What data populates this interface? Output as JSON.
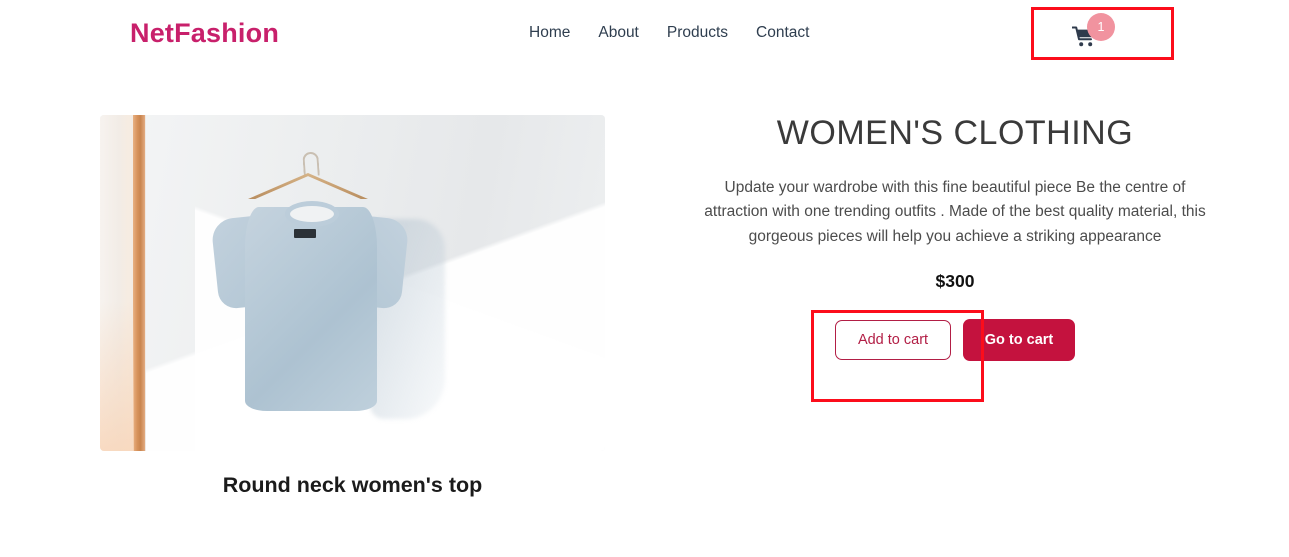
{
  "header": {
    "brand": "NetFashion",
    "nav": [
      {
        "label": "Home"
      },
      {
        "label": "About"
      },
      {
        "label": "Products"
      },
      {
        "label": "Contact"
      }
    ],
    "cart": {
      "icon": "shopping-cart-icon",
      "badge_count": "1",
      "badge_color": "#f1939f"
    }
  },
  "product": {
    "image_alt": "light blue t-shirt on wooden hanger against white wall",
    "caption": "Round neck women's top",
    "title": "WOMEN'S CLOTHING",
    "description": "Update your wardrobe with this fine beautiful piece Be the centre of attraction with one trending outfits . Made of the best quality material, this gorgeous pieces will help you achieve a striking appearance",
    "price": "$300",
    "add_to_cart_label": "Add to cart",
    "go_to_cart_label": "Go to cart"
  },
  "colors": {
    "brand": "#c8206b",
    "primary": "#c4123e",
    "outline": "#b21e45",
    "annotation": "#fc0d1b",
    "nav_text": "#2f3e4f"
  }
}
